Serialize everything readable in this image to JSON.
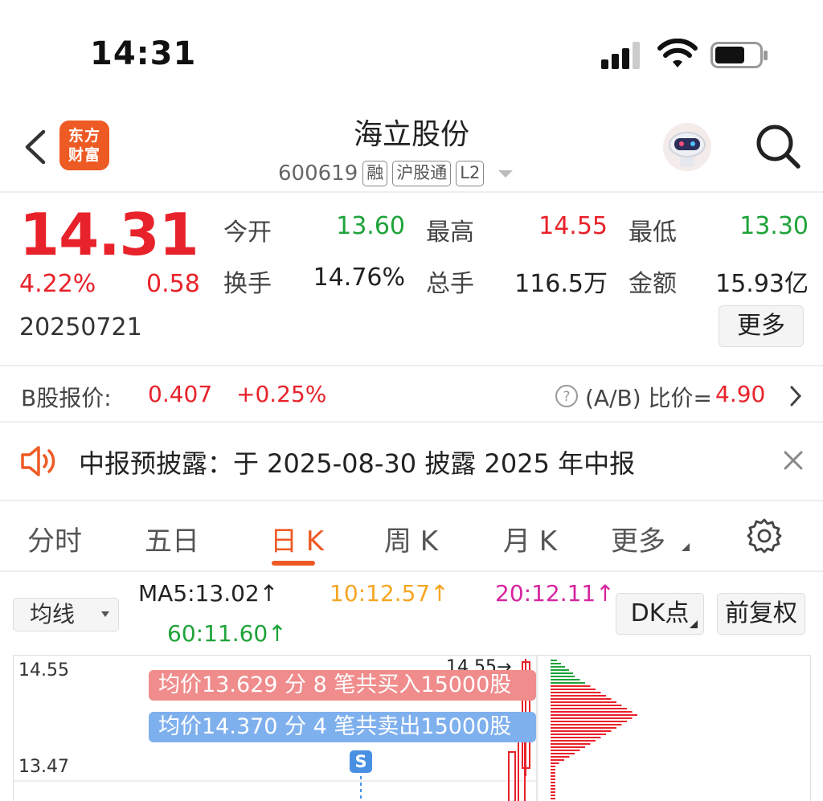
{
  "status_bar": {
    "time": "14:31"
  },
  "header": {
    "logo_text_1": "东方",
    "logo_text_2": "财富",
    "title": "海立股份",
    "code": "600619",
    "tags": [
      "融",
      "沪股通",
      "L2"
    ]
  },
  "quote": {
    "price": "14.31",
    "change_pct": "4.22%",
    "change": "0.58",
    "date": "20250721",
    "stats": [
      {
        "label": "今开",
        "value": "13.60",
        "color": "green"
      },
      {
        "label": "最高",
        "value": "14.55",
        "color": "red"
      },
      {
        "label": "最低",
        "value": "13.30",
        "color": "green"
      },
      {
        "label": "换手",
        "value": "14.76%",
        "color": "dark"
      },
      {
        "label": "总手",
        "value": "116.5万",
        "color": "dark"
      },
      {
        "label": "金额",
        "value": "15.93亿",
        "color": "dark"
      }
    ],
    "more_label": "更多"
  },
  "b_share": {
    "label": "B股报价:",
    "price": "0.407",
    "change_pct": "+0.25%",
    "ratio_label": "(A/B) 比价=",
    "ratio_value": "4.90"
  },
  "notice": {
    "text": "中报预披露：于 2025-08-30 披露 2025 年中报"
  },
  "tabs": [
    {
      "label": "分时",
      "active": false
    },
    {
      "label": "五日",
      "active": false
    },
    {
      "label": "日 K",
      "active": true
    },
    {
      "label": "周 K",
      "active": false
    },
    {
      "label": "月 K",
      "active": false
    },
    {
      "label": "更多",
      "active": false
    }
  ],
  "chart_toolbar": {
    "indicator_select": "均线",
    "ma5": "MA5:13.02↑",
    "ma10": "10:12.57↑",
    "ma20": "20:12.11↑",
    "ma60": "60:11.60↑",
    "dk_button": "DK点",
    "fq_button": "前复权"
  },
  "chart": {
    "y_top": "14.55",
    "y_mid": "13.47",
    "max_marker": "14.55→",
    "buy_band": "均价13.629 分 8 笔共买入15000股",
    "sell_band": "均价14.370 分 4 笔共卖出15000股",
    "signal": "S",
    "colors": {
      "red": "#e8222a",
      "green": "#1ea33a",
      "ma10": "#f5a623",
      "ma20": "#d6249f",
      "accent": "#ee5a24"
    }
  }
}
